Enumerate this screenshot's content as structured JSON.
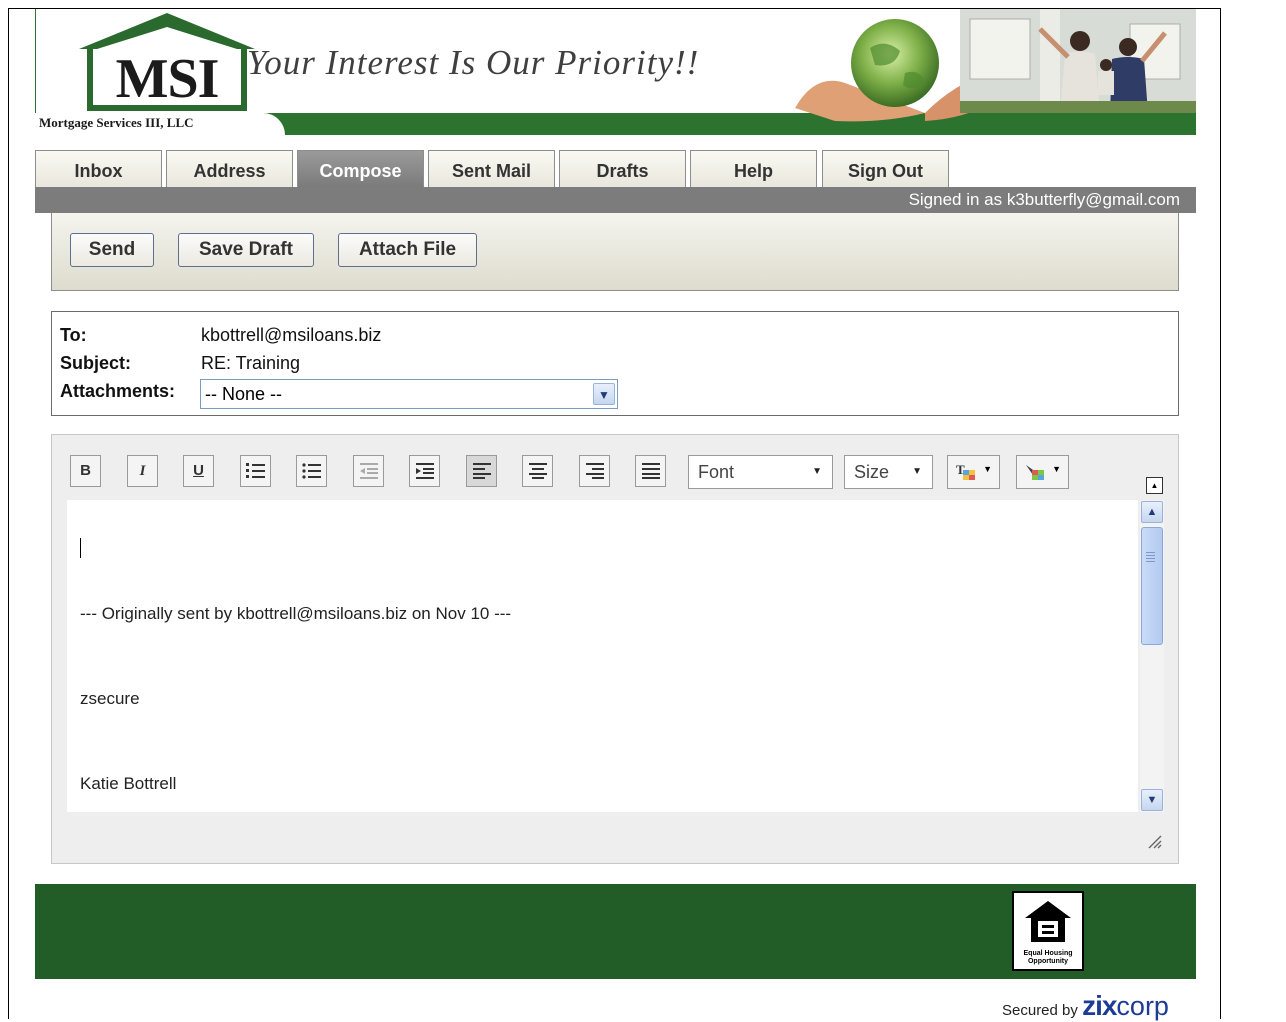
{
  "banner": {
    "logo_text": "MSI",
    "company": "Mortgage Services III, LLC",
    "slogan": "Your Interest Is Our Priority!!"
  },
  "tabs": [
    {
      "label": "Inbox"
    },
    {
      "label": "Address"
    },
    {
      "label": "Compose",
      "active": true
    },
    {
      "label": "Sent Mail"
    },
    {
      "label": "Drafts"
    },
    {
      "label": "Help"
    },
    {
      "label": "Sign Out"
    }
  ],
  "status": {
    "signed_in": "Signed in as k3butterfly@gmail.com"
  },
  "toolbar": {
    "send": "Send",
    "save_draft": "Save Draft",
    "attach_file": "Attach File"
  },
  "headers": {
    "to_label": "To:",
    "to_value": "kbottrell@msiloans.biz",
    "subject_label": "Subject:",
    "subject_value": "RE: Training",
    "attachments_label": "Attachments:",
    "attachments_value": "-- None --"
  },
  "editor": {
    "buttons": [
      {
        "name": "bold-icon",
        "glyph": "B"
      },
      {
        "name": "italic-icon",
        "glyph": "I"
      },
      {
        "name": "underline-icon",
        "glyph": "U"
      },
      {
        "name": "ordered-list-icon"
      },
      {
        "name": "unordered-list-icon"
      },
      {
        "name": "outdent-icon"
      },
      {
        "name": "indent-icon"
      },
      {
        "name": "align-left-icon"
      },
      {
        "name": "align-center-icon"
      },
      {
        "name": "align-right-icon"
      },
      {
        "name": "justify-icon"
      }
    ],
    "font_label": "Font",
    "size_label": "Size",
    "body": {
      "original_note": "--- Originally sent by kbottrell@msiloans.biz on Nov 10 ---",
      "line1": "zsecure",
      "line2": "Katie Bottrell"
    }
  },
  "footer": {
    "eho_line1": "Equal Housing",
    "eho_line2": "Opportunity",
    "secured_by": "Secured by",
    "zix": "zix",
    "corp": "corp"
  },
  "colors": {
    "banner_green": "#2c7330",
    "footer_green": "#225c26",
    "status_gray": "#7c7c7c"
  }
}
